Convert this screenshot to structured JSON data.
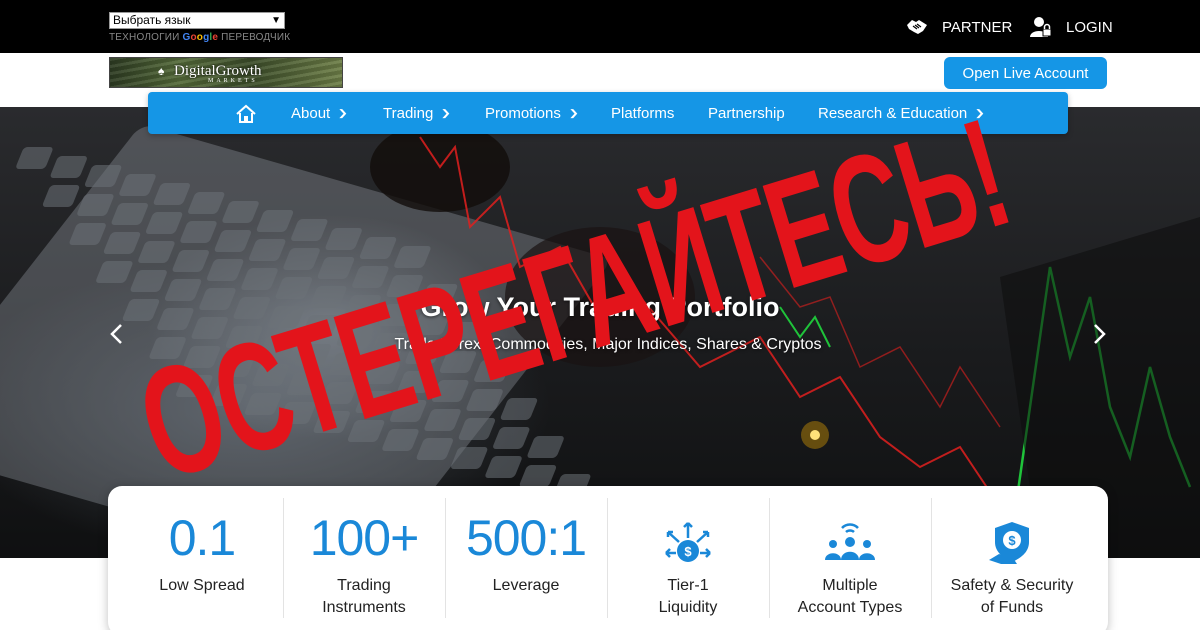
{
  "translate": {
    "select_value": "Выбрать язык",
    "powered_prefix": "ТЕХНОЛОГИИ",
    "google_word": [
      "G",
      "o",
      "o",
      "g",
      "l",
      "e"
    ],
    "powered_suffix": "ПЕРЕВОДЧИК"
  },
  "top_links": {
    "partner": "PARTNER",
    "login": "LOGIN"
  },
  "logo": {
    "name": "DigitalGrowth",
    "sub": "MARKETS"
  },
  "cta": {
    "label": "Open Live Account"
  },
  "nav": {
    "items": [
      {
        "label": "About",
        "dropdown": true
      },
      {
        "label": "Trading",
        "dropdown": true
      },
      {
        "label": "Promotions",
        "dropdown": true
      },
      {
        "label": "Platforms",
        "dropdown": false
      },
      {
        "label": "Partnership",
        "dropdown": false
      },
      {
        "label": "Research & Education",
        "dropdown": true
      }
    ]
  },
  "hero": {
    "title": "Grow Your Trading Portfolio",
    "subtitle": "Trade Forex, Commodities, Major Indices, Shares & Cryptos"
  },
  "overlay": {
    "text": "ОСТЕРЕГАЙТЕСЬ!"
  },
  "stats": [
    {
      "value": "0.1",
      "label_1": "Low Spread",
      "label_2": ""
    },
    {
      "value": "100+",
      "label_1": "Trading",
      "label_2": "Instruments"
    },
    {
      "value": "500:1",
      "label_1": "Leverage",
      "label_2": ""
    },
    {
      "icon": "liquidity-icon",
      "label_1": "Tier-1",
      "label_2": "Liquidity"
    },
    {
      "icon": "account-types-icon",
      "label_1": "Multiple",
      "label_2": "Account Types"
    },
    {
      "icon": "security-shield-icon",
      "label_1": "Safety & Security",
      "label_2": "of Funds"
    }
  ],
  "colors": {
    "brand_blue": "#1596e6",
    "stat_blue": "#1a88d8",
    "warning_red": "#e3141b",
    "chart_green": "#1fc33a",
    "chart_red": "#e0201e"
  }
}
